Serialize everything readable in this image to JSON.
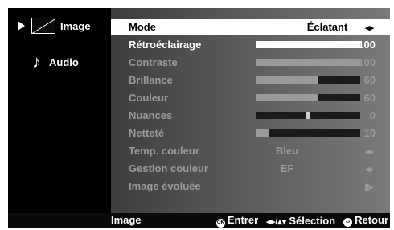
{
  "sidebar": {
    "items": [
      {
        "label": "Image",
        "icon": "image-icon",
        "selected": true
      },
      {
        "label": "Audio",
        "icon": "music-note-icon",
        "selected": false
      }
    ]
  },
  "menu": {
    "mode": {
      "label": "Mode",
      "value": "Éclatant"
    },
    "items": [
      {
        "label": "Rétroéclairage",
        "value": "100",
        "level": 100,
        "active": true
      },
      {
        "label": "Contraste",
        "value": "100",
        "level": 100
      },
      {
        "label": "Brillance",
        "value": "60",
        "level": 60
      },
      {
        "label": "Couleur",
        "value": "60",
        "level": 60
      },
      {
        "label": "Nuances",
        "value": "0",
        "center": true
      },
      {
        "label": "Netteté",
        "value": "10",
        "level": 10
      },
      {
        "label": "Temp. couleur",
        "text_value": "Bleu"
      },
      {
        "label": "Gestion couleur",
        "text_value": "EF"
      },
      {
        "label": "Image évoluée",
        "submenu": true
      }
    ]
  },
  "footer": {
    "breadcrumb": "Image",
    "enter_label": "Entrer",
    "ok_icon_text": "OK",
    "select_label": "Sélection",
    "arrows_text": "◂▸/▴▾",
    "return_label": "Retour"
  }
}
